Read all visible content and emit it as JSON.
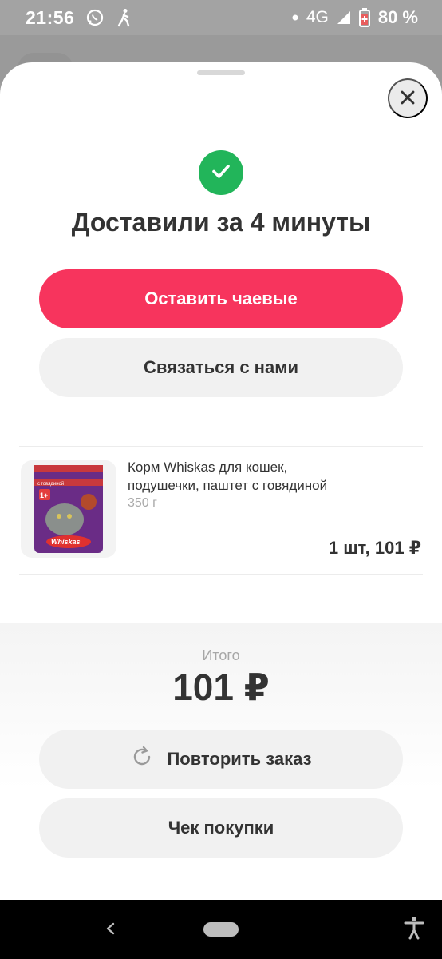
{
  "status_bar": {
    "time": "21:56",
    "network": "4G",
    "battery": "80 %",
    "icons": [
      "whatsapp-icon",
      "walking-icon",
      "dot-icon",
      "signal-icon",
      "battery-icon"
    ]
  },
  "sheet": {
    "title": "Доставили за 4 минуты",
    "tip_button": "Оставить чаевые",
    "contact_button": "Связаться с нами",
    "icons": [
      "close-icon",
      "check-icon"
    ]
  },
  "product": {
    "name": "Корм Whiskas для кошек, подушечки, паштет с говядиной",
    "weight": "350 г",
    "quantity_price": "1 шт, 101 ₽",
    "image_brand": "Whiskas",
    "image_badge": "1+",
    "image_flavor": "с говядиной"
  },
  "summary": {
    "total_label": "Итого",
    "total_value": "101 ₽",
    "repeat_button": "Повторить заказ",
    "receipt_button": "Чек покупки"
  },
  "colors": {
    "accent": "#f7345d",
    "success": "#22b55a",
    "button_gray": "#f1f1f1"
  },
  "nav_bar": {
    "icons": [
      "back-icon",
      "home-pill",
      "accessibility-icon"
    ]
  }
}
